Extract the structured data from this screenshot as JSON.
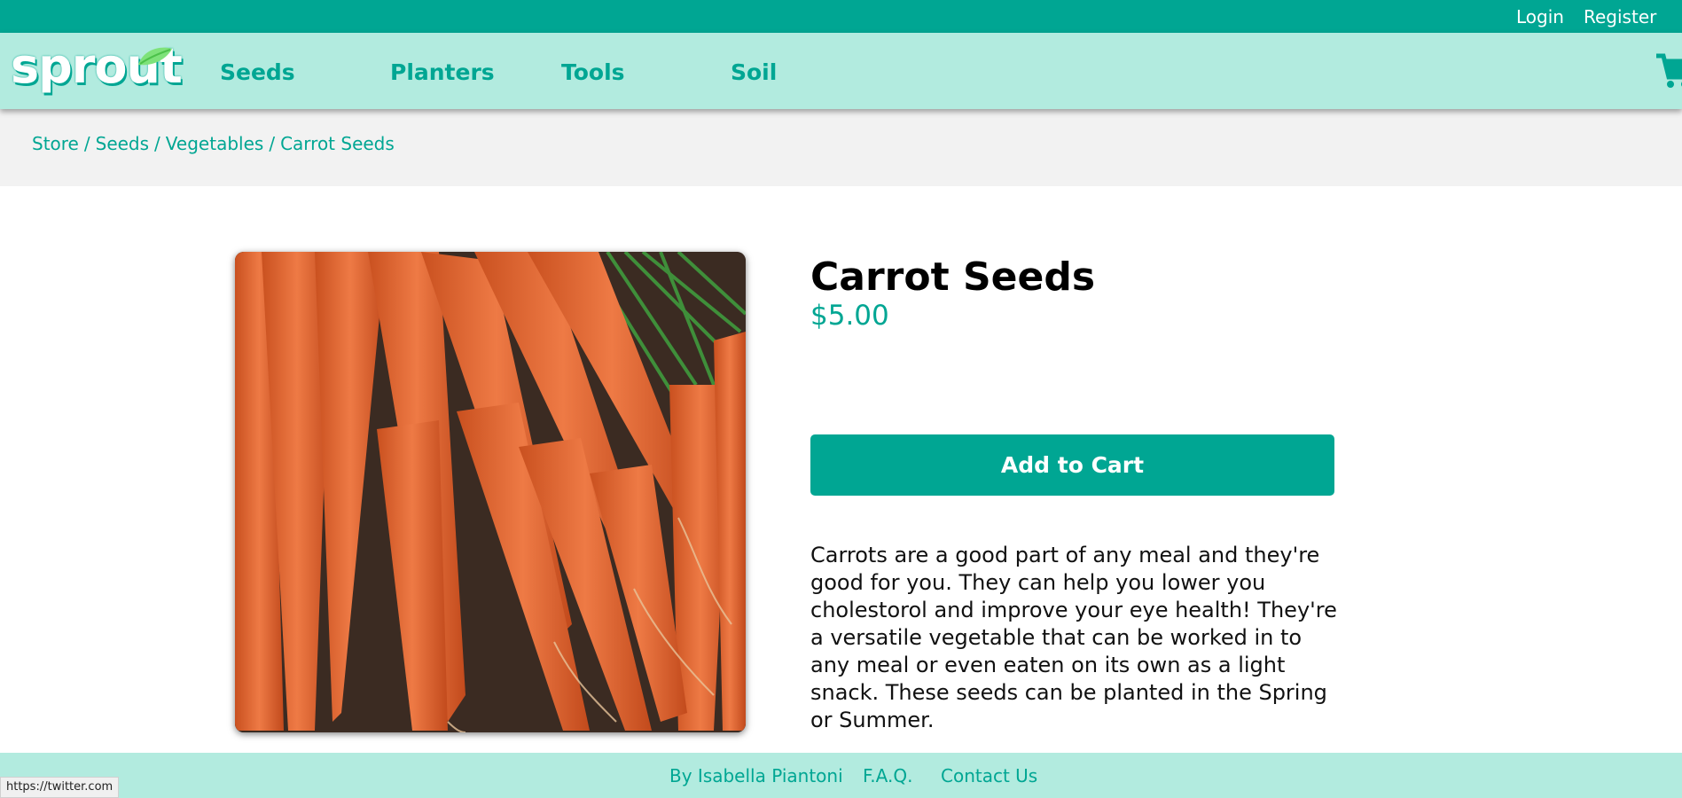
{
  "topbar": {
    "login_label": "Login",
    "register_label": "Register"
  },
  "navbar": {
    "logo_text": "sprout",
    "items": [
      {
        "label": "Seeds"
      },
      {
        "label": "Planters"
      },
      {
        "label": "Tools"
      },
      {
        "label": "Soil"
      }
    ],
    "cart_icon": "shopping-cart-icon"
  },
  "breadcrumb": {
    "items": [
      "Store",
      "Seeds",
      "Vegetables",
      "Carrot Seeds"
    ],
    "separator": "/"
  },
  "product": {
    "title": "Carrot Seeds",
    "price": "$5.00",
    "add_to_cart_label": "Add to Cart",
    "description": "Carrots are a good part of any meal and they're good for you. They can help you lower you cholestorol and improve your eye health! They're a versatile vegetable that can be worked in to any meal or even eaten on its own as a light snack. These seeds can be planted in the Spring or Summer."
  },
  "footer": {
    "links": [
      {
        "label": "By Isabella Piantoni"
      },
      {
        "label": "F.A.Q."
      },
      {
        "label": "Contact Us"
      }
    ]
  },
  "status_bar": {
    "url": "https://twitter.com"
  },
  "colors": {
    "accent": "#00a693",
    "nav_background": "#b2ebdf",
    "breadcrumb_background": "#f2f2f2"
  }
}
